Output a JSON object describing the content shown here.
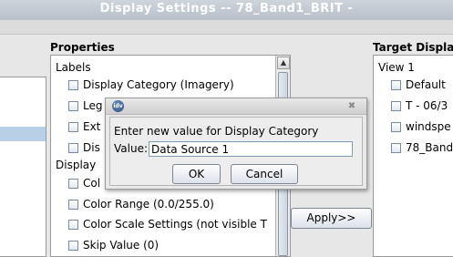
{
  "window": {
    "title": "Display Settings -- 78_Band1_BRIT -"
  },
  "properties": {
    "heading": "Properties",
    "labels_group": "Labels",
    "display_group": "Display",
    "items": [
      {
        "label": "Display Category (Imagery)"
      },
      {
        "label": "Leg"
      },
      {
        "label": "Ext"
      },
      {
        "label": "Dis"
      },
      {
        "label": "Col"
      },
      {
        "label": "Color Range (0.0/255.0)"
      },
      {
        "label": "Color Scale Settings (not visible T"
      },
      {
        "label": "Skip Value (0)"
      }
    ]
  },
  "apply_button": {
    "label": "Apply>>"
  },
  "target": {
    "heading": "Target Display",
    "view_label": "View 1",
    "items": [
      {
        "label": "Default"
      },
      {
        "label": "T - 06/3"
      },
      {
        "label": "windspe"
      },
      {
        "label": "78_Band"
      }
    ]
  },
  "dialog": {
    "app_icon": "idv",
    "close_icon_glyph": "✖",
    "prompt": "Enter new value for Display Category",
    "value_label": "Value:",
    "value": "Data Source 1",
    "ok_label": "OK",
    "cancel_label": "Cancel"
  },
  "scroll_glyphs": {
    "up": "▲",
    "down": "▼"
  }
}
